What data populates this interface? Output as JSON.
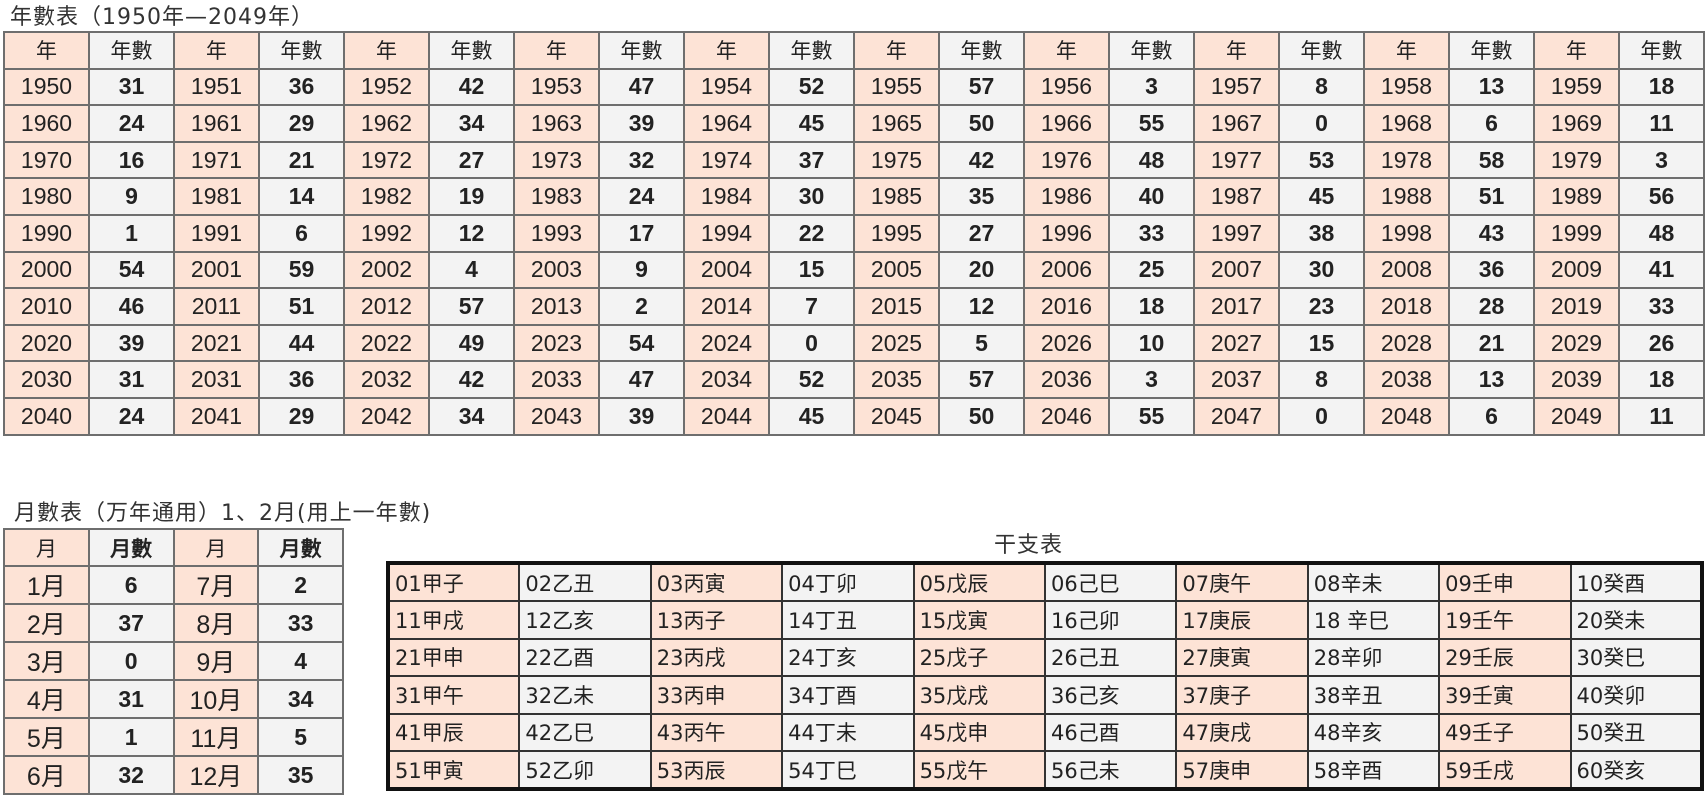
{
  "year_table": {
    "title": "年數表（1950年—2049年）",
    "header_year": "年",
    "header_num": "年數",
    "rows": [
      [
        [
          "1950",
          "31"
        ],
        [
          "1951",
          "36"
        ],
        [
          "1952",
          "42"
        ],
        [
          "1953",
          "47"
        ],
        [
          "1954",
          "52"
        ],
        [
          "1955",
          "57"
        ],
        [
          "1956",
          "3"
        ],
        [
          "1957",
          "8"
        ],
        [
          "1958",
          "13"
        ],
        [
          "1959",
          "18"
        ]
      ],
      [
        [
          "1960",
          "24"
        ],
        [
          "1961",
          "29"
        ],
        [
          "1962",
          "34"
        ],
        [
          "1963",
          "39"
        ],
        [
          "1964",
          "45"
        ],
        [
          "1965",
          "50"
        ],
        [
          "1966",
          "55"
        ],
        [
          "1967",
          "0"
        ],
        [
          "1968",
          "6"
        ],
        [
          "1969",
          "11"
        ]
      ],
      [
        [
          "1970",
          "16"
        ],
        [
          "1971",
          "21"
        ],
        [
          "1972",
          "27"
        ],
        [
          "1973",
          "32"
        ],
        [
          "1974",
          "37"
        ],
        [
          "1975",
          "42"
        ],
        [
          "1976",
          "48"
        ],
        [
          "1977",
          "53"
        ],
        [
          "1978",
          "58"
        ],
        [
          "1979",
          "3"
        ]
      ],
      [
        [
          "1980",
          "9"
        ],
        [
          "1981",
          "14"
        ],
        [
          "1982",
          "19"
        ],
        [
          "1983",
          "24"
        ],
        [
          "1984",
          "30"
        ],
        [
          "1985",
          "35"
        ],
        [
          "1986",
          "40"
        ],
        [
          "1987",
          "45"
        ],
        [
          "1988",
          "51"
        ],
        [
          "1989",
          "56"
        ]
      ],
      [
        [
          "1990",
          "1"
        ],
        [
          "1991",
          "6"
        ],
        [
          "1992",
          "12"
        ],
        [
          "1993",
          "17"
        ],
        [
          "1994",
          "22"
        ],
        [
          "1995",
          "27"
        ],
        [
          "1996",
          "33"
        ],
        [
          "1997",
          "38"
        ],
        [
          "1998",
          "43"
        ],
        [
          "1999",
          "48"
        ]
      ],
      [
        [
          "2000",
          "54"
        ],
        [
          "2001",
          "59"
        ],
        [
          "2002",
          "4"
        ],
        [
          "2003",
          "9"
        ],
        [
          "2004",
          "15"
        ],
        [
          "2005",
          "20"
        ],
        [
          "2006",
          "25"
        ],
        [
          "2007",
          "30"
        ],
        [
          "2008",
          "36"
        ],
        [
          "2009",
          "41"
        ]
      ],
      [
        [
          "2010",
          "46"
        ],
        [
          "2011",
          "51"
        ],
        [
          "2012",
          "57"
        ],
        [
          "2013",
          "2"
        ],
        [
          "2014",
          "7"
        ],
        [
          "2015",
          "12"
        ],
        [
          "2016",
          "18"
        ],
        [
          "2017",
          "23"
        ],
        [
          "2018",
          "28"
        ],
        [
          "2019",
          "33"
        ]
      ],
      [
        [
          "2020",
          "39"
        ],
        [
          "2021",
          "44"
        ],
        [
          "2022",
          "49"
        ],
        [
          "2023",
          "54"
        ],
        [
          "2024",
          "0"
        ],
        [
          "2025",
          "5"
        ],
        [
          "2026",
          "10"
        ],
        [
          "2027",
          "15"
        ],
        [
          "2028",
          "21"
        ],
        [
          "2029",
          "26"
        ]
      ],
      [
        [
          "2030",
          "31"
        ],
        [
          "2031",
          "36"
        ],
        [
          "2032",
          "42"
        ],
        [
          "2033",
          "47"
        ],
        [
          "2034",
          "52"
        ],
        [
          "2035",
          "57"
        ],
        [
          "2036",
          "3"
        ],
        [
          "2037",
          "8"
        ],
        [
          "2038",
          "13"
        ],
        [
          "2039",
          "18"
        ]
      ],
      [
        [
          "2040",
          "24"
        ],
        [
          "2041",
          "29"
        ],
        [
          "2042",
          "34"
        ],
        [
          "2043",
          "39"
        ],
        [
          "2044",
          "45"
        ],
        [
          "2045",
          "50"
        ],
        [
          "2046",
          "55"
        ],
        [
          "2047",
          "0"
        ],
        [
          "2048",
          "6"
        ],
        [
          "2049",
          "11"
        ]
      ]
    ]
  },
  "month_table": {
    "title": "月數表（万年通用）1、2月(用上一年數)",
    "header_month": "月",
    "header_num": "月數",
    "rows": [
      [
        [
          "1月",
          "6"
        ],
        [
          "7月",
          "2"
        ]
      ],
      [
        [
          "2月",
          "37"
        ],
        [
          "8月",
          "33"
        ]
      ],
      [
        [
          "3月",
          "0"
        ],
        [
          "9月",
          "4"
        ]
      ],
      [
        [
          "4月",
          "31"
        ],
        [
          "10月",
          "34"
        ]
      ],
      [
        [
          "5月",
          "1"
        ],
        [
          "11月",
          "5"
        ]
      ],
      [
        [
          "6月",
          "32"
        ],
        [
          "12月",
          "35"
        ]
      ]
    ]
  },
  "ganzhi_table": {
    "title": "干支表",
    "rows": [
      [
        "01甲子",
        "02乙丑",
        "03丙寅",
        "04丁卯",
        "05戊辰",
        "06己巳",
        "07庚午",
        "08辛未",
        "09壬申",
        "10癸酉"
      ],
      [
        "11甲戌",
        "12乙亥",
        "13丙子",
        "14丁丑",
        "15戊寅",
        "16己卯",
        "17庚辰",
        "18 辛巳",
        "19壬午",
        "20癸未"
      ],
      [
        "21甲申",
        "22乙酉",
        "23丙戌",
        "24丁亥",
        "25戊子",
        "26己丑",
        "27庚寅",
        "28辛卯",
        "29壬辰",
        "30癸巳"
      ],
      [
        "31甲午",
        "32乙未",
        "33丙申",
        "34丁酉",
        "35戊戌",
        "36己亥",
        "37庚子",
        "38辛丑",
        "39壬寅",
        "40癸卯"
      ],
      [
        "41甲辰",
        "42乙巳",
        "43丙午",
        "44丁未",
        "45戊申",
        "46己酉",
        "47庚戌",
        "48辛亥",
        "49壬子",
        "50癸丑"
      ],
      [
        "51甲寅",
        "52乙卯",
        "53丙辰",
        "54丁巳",
        "55戊午",
        "56己未",
        "57庚申",
        "58辛酉",
        "59壬戌",
        "60癸亥"
      ]
    ]
  },
  "colors": {
    "year_cell": "#fde3d6",
    "num_cell": "#f3f3f3",
    "border": "#6e6e6e"
  }
}
